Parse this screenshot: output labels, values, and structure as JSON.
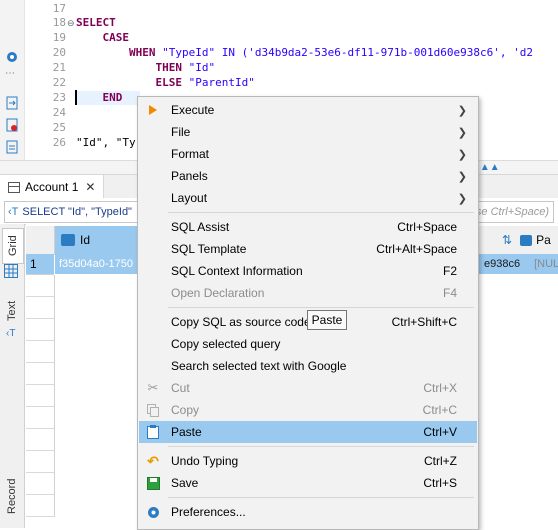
{
  "editor": {
    "lines": [
      {
        "num": "17",
        "text": ""
      },
      {
        "num": "18",
        "kw": "SELECT",
        "rest": ""
      },
      {
        "num": "19",
        "indent": "    ",
        "kw": "CASE",
        "rest": ""
      },
      {
        "num": "20",
        "indent": "        ",
        "kw": "WHEN",
        "rest": " \"TypeId\" IN ('d34b9da2-53e6-df11-971b-001d60e938c6', 'd2"
      },
      {
        "num": "21",
        "indent": "            ",
        "kw": "THEN",
        "rest": " \"Id\""
      },
      {
        "num": "22",
        "indent": "            ",
        "kw": "ELSE",
        "rest": " \"ParentId\""
      },
      {
        "num": "23",
        "indent": "    ",
        "kw": "END",
        "rest": ""
      },
      {
        "num": "24",
        "text": ""
      },
      {
        "num": "25",
        "text": ""
      },
      {
        "num": "26",
        "text": "\"Id\", \"Ty"
      }
    ]
  },
  "tabs": {
    "account_label": "Account 1"
  },
  "filter": {
    "query_text": "SELECT \"Id\", \"TypeId\"",
    "hint_text": "use Ctrl+Space)"
  },
  "side_tabs": {
    "grid": "Grid",
    "text": "Text",
    "record": "Record"
  },
  "grid": {
    "col_id": "Id",
    "row_num": "1",
    "row_id": "f35d04a0-1750",
    "row_right": "e938c6",
    "row_null": "[NUL",
    "col_right": "Pa"
  },
  "menu": {
    "execute": "Execute",
    "file": "File",
    "format": "Format",
    "panels": "Panels",
    "layout": "Layout",
    "sql_assist": "SQL Assist",
    "sql_assist_sc": "Ctrl+Space",
    "sql_template": "SQL Template",
    "sql_template_sc": "Ctrl+Alt+Space",
    "sql_context": "SQL Context Information",
    "sql_context_sc": "F2",
    "open_decl": "Open Declaration",
    "open_decl_sc": "F4",
    "copy_sql": "Copy SQL as source code",
    "copy_sql_sc": "Ctrl+Shift+C",
    "copy_query": "Copy selected query",
    "search_google": "Search selected text with Google",
    "cut": "Cut",
    "cut_sc": "Ctrl+X",
    "copy": "Copy",
    "copy_sc": "Ctrl+C",
    "paste": "Paste",
    "paste_sc": "Ctrl+V",
    "undo": "Undo Typing",
    "undo_sc": "Ctrl+Z",
    "save": "Save",
    "save_sc": "Ctrl+S",
    "preferences": "Preferences..."
  },
  "tooltip": {
    "text": "Paste"
  },
  "colors": {
    "highlight": "#99c9ef",
    "accent": "#2c7cc4",
    "keyword": "#7f0055",
    "string": "#2a00ff"
  }
}
